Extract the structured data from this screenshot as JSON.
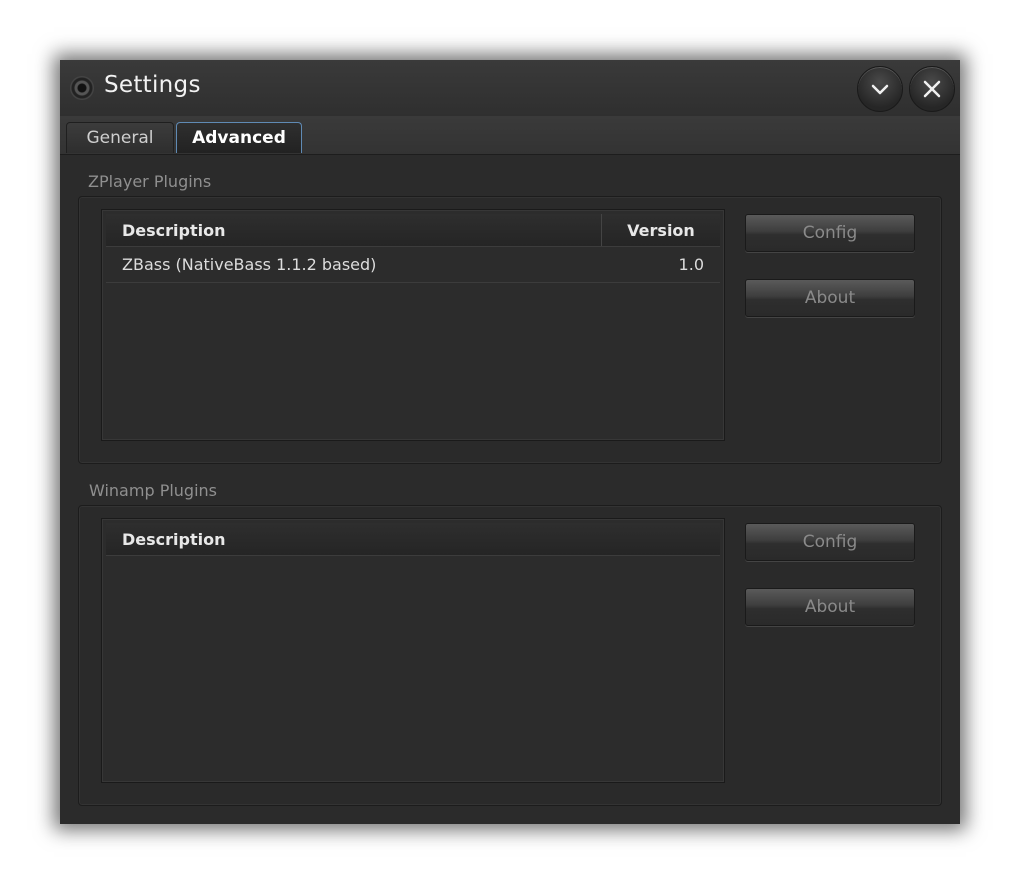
{
  "window": {
    "title": "Settings",
    "collapse_icon": "chevron-down-icon",
    "close_icon": "close-icon"
  },
  "tabs": [
    {
      "label": "General",
      "active": false
    },
    {
      "label": "Advanced",
      "active": true
    }
  ],
  "zplayer": {
    "group_label": "ZPlayer Plugins",
    "columns": [
      "Description",
      "Version"
    ],
    "rows": [
      {
        "description": "ZBass (NativeBass 1.1.2 based)",
        "version": "1.0"
      }
    ],
    "config_label": "Config",
    "about_label": "About"
  },
  "winamp": {
    "group_label": "Winamp Plugins",
    "columns": [
      "Description"
    ],
    "rows": [],
    "config_label": "Config",
    "about_label": "About"
  },
  "colors": {
    "window_bg": "#2b2b2b",
    "active_tab_border": "#5f8ab4",
    "disabled_text": "#8a8a8a"
  }
}
